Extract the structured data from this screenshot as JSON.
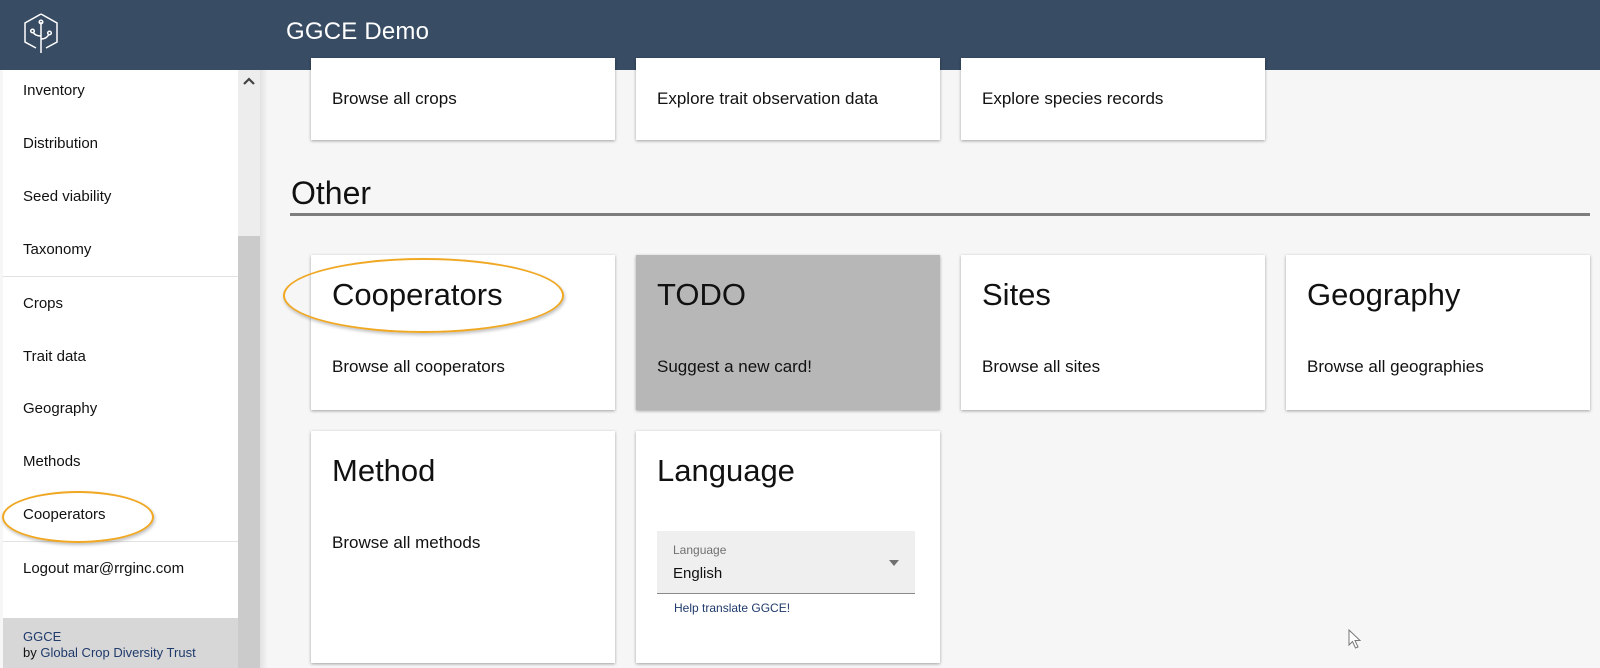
{
  "header": {
    "title": "GGCE Demo",
    "logo_icon": "tree-hexagon-logo"
  },
  "sidebar": {
    "items_top": [
      {
        "label": "Inventory"
      },
      {
        "label": "Distribution"
      },
      {
        "label": "Seed viability"
      },
      {
        "label": "Taxonomy"
      }
    ],
    "items_bottom": [
      {
        "label": "Crops"
      },
      {
        "label": "Trait data"
      },
      {
        "label": "Geography"
      },
      {
        "label": "Methods"
      },
      {
        "label": "Cooperators"
      }
    ],
    "logout_label": "Logout",
    "user_email": "mar@rrginc.com",
    "footer": {
      "app": "GGCE",
      "by": "by",
      "org": "Global Crop Diversity Trust"
    }
  },
  "main": {
    "top_cards": [
      {
        "description": "Browse all crops"
      },
      {
        "description": "Explore trait observation data"
      },
      {
        "description": "Explore species records"
      }
    ],
    "section_title": "Other",
    "cards": [
      {
        "title": "Cooperators",
        "description": "Browse all cooperators"
      },
      {
        "title": "TODO",
        "description": "Suggest a new card!"
      },
      {
        "title": "Sites",
        "description": "Browse all sites"
      },
      {
        "title": "Geography",
        "description": "Browse all geographies"
      },
      {
        "title": "Method",
        "description": "Browse all methods"
      }
    ],
    "language_card": {
      "title": "Language",
      "select_label": "Language",
      "select_value": "English",
      "help_link": "Help translate GGCE!"
    }
  },
  "colors": {
    "header_bg": "#384c64",
    "highlight": "#f0a823",
    "todo_card_bg": "#b7b7b7",
    "link": "#1f3a6b"
  }
}
